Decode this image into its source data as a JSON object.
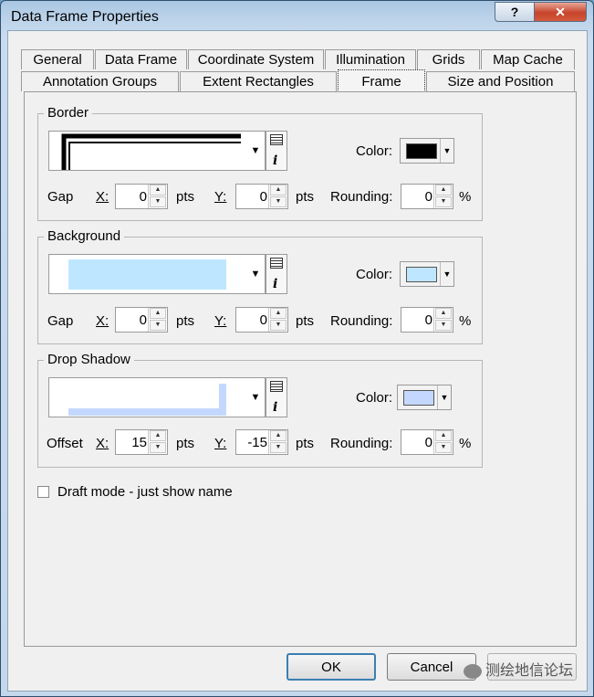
{
  "window": {
    "title": "Data Frame Properties",
    "help_glyph": "?",
    "close_glyph": "✕"
  },
  "tabs": {
    "row1": [
      "General",
      "Data Frame",
      "Coordinate System",
      "Illumination",
      "Grids",
      "Map Cache"
    ],
    "row2": [
      "Annotation Groups",
      "Extent Rectangles",
      "Frame",
      "Size and Position"
    ],
    "active": "Frame"
  },
  "border": {
    "label": "Border",
    "color_label": "Color:",
    "color": "#000000",
    "gap_label": "Gap",
    "x_label": "X:",
    "x_value": "0",
    "y_label": "Y:",
    "y_value": "0",
    "pts": "pts",
    "rounding_label": "Rounding:",
    "rounding_value": "0",
    "percent": "%"
  },
  "background": {
    "label": "Background",
    "color_label": "Color:",
    "color": "#bfe6ff",
    "preview_color": "#bfe6ff",
    "gap_label": "Gap",
    "x_label": "X:",
    "x_value": "0",
    "y_label": "Y:",
    "y_value": "0",
    "pts": "pts",
    "rounding_label": "Rounding:",
    "rounding_value": "0",
    "percent": "%"
  },
  "drop_shadow": {
    "label": "Drop Shadow",
    "color_label": "Color:",
    "color": "#c4d8ff",
    "preview_color": "#c4d8ff",
    "offset_label": "Offset",
    "x_label": "X:",
    "x_value": "15",
    "y_label": "Y:",
    "y_value": "-15",
    "pts": "pts",
    "rounding_label": "Rounding:",
    "rounding_value": "0",
    "percent": "%"
  },
  "draft_mode": {
    "label": "Draft mode - just show name",
    "checked": false
  },
  "buttons": {
    "ok": "OK",
    "cancel": "Cancel"
  },
  "watermark": "测绘地信论坛"
}
